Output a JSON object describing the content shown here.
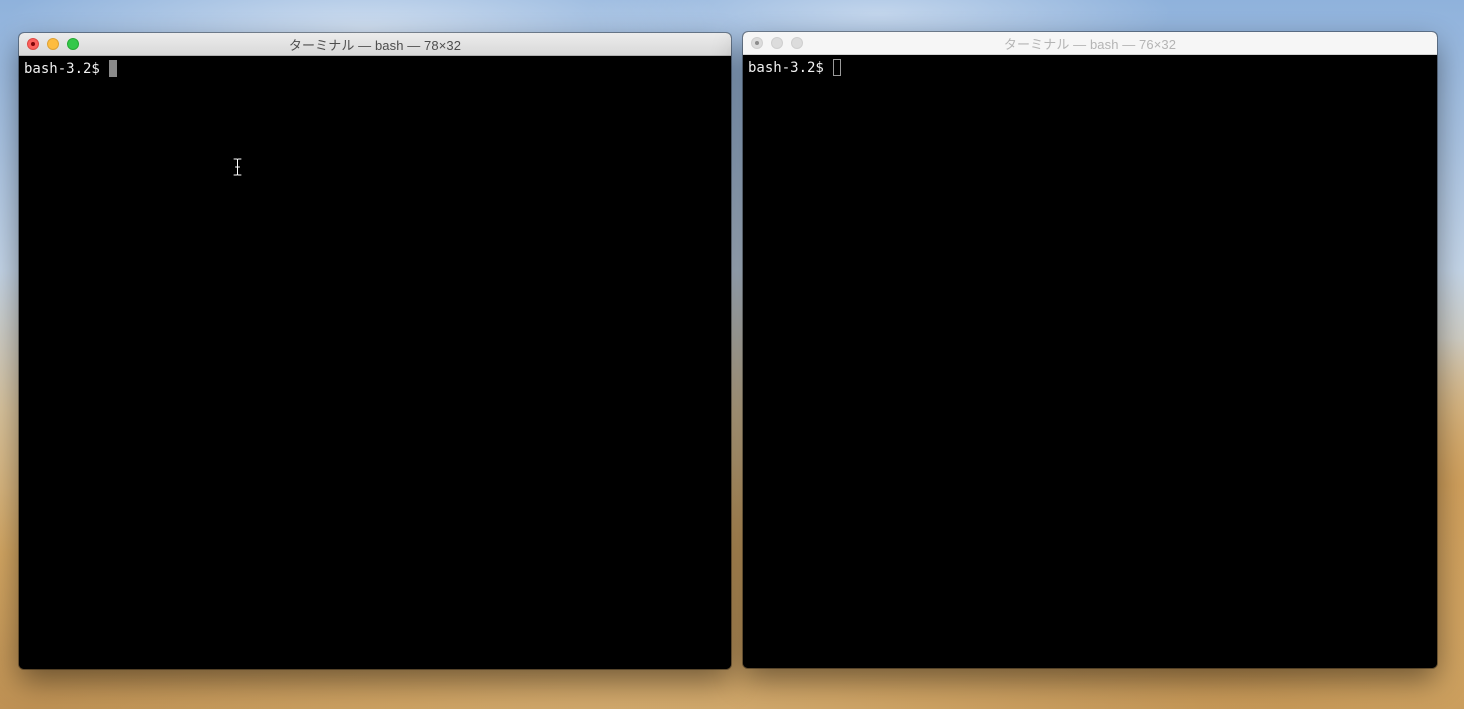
{
  "windows": {
    "left": {
      "title": "ターミナル — bash — 78×32",
      "prompt": "bash-3.2$",
      "state": "active"
    },
    "right": {
      "title": "ターミナル — bash — 76×32",
      "prompt": "bash-3.2$",
      "state": "inactive"
    }
  },
  "colors": {
    "terminal_bg": "#000000",
    "terminal_fg": "#f0f0f0",
    "close": "#fc605c",
    "minimize": "#fdbc40",
    "zoom": "#34c84a"
  },
  "icons": {
    "mouse_pointer": "ibeam-cursor-icon"
  }
}
